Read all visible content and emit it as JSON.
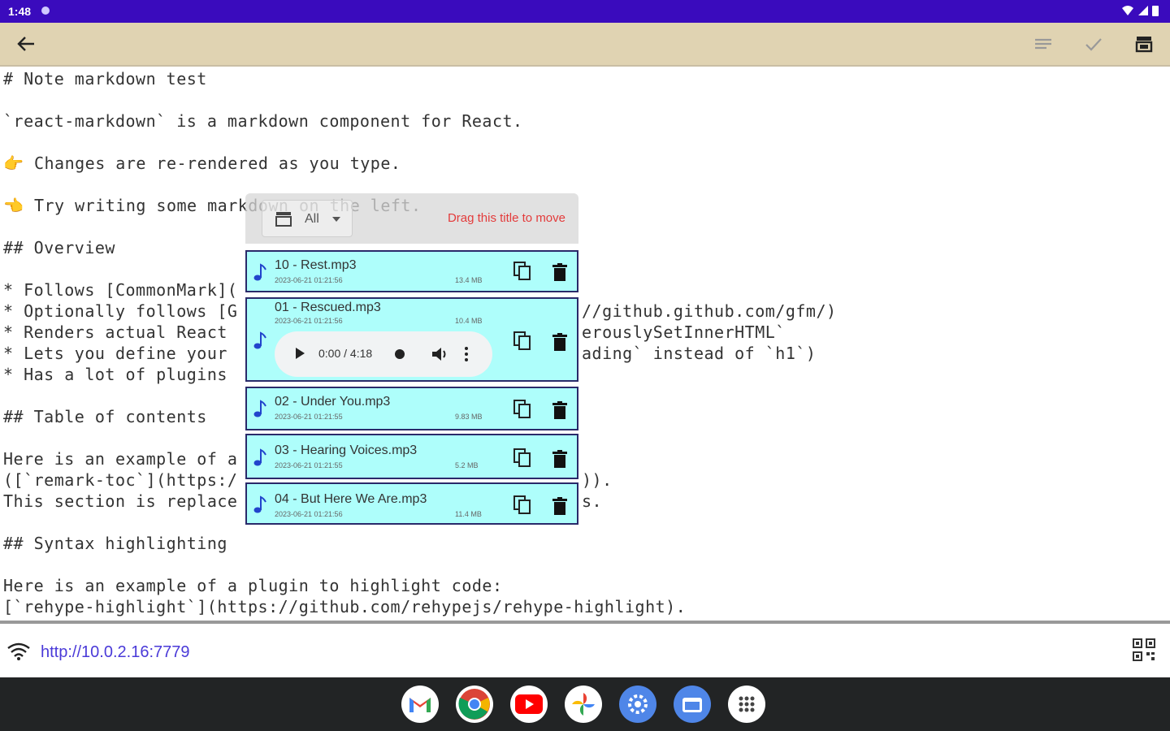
{
  "status_bar": {
    "time": "1:48"
  },
  "app_bar": {
    "back_icon": "arrow-left-icon",
    "actions": [
      "wrap-text-icon",
      "check-icon",
      "music-list-icon"
    ]
  },
  "editor": {
    "lines": [
      "# Note markdown test",
      "",
      "`react-markdown` is a markdown component for React.",
      "",
      "👉 Changes are re-rendered as you type.",
      "",
      "👈 Try writing some markdown on the left.",
      "",
      "## Overview",
      "",
      "* Follows [CommonMark](",
      "* Optionally follows [G",
      "* Renders actual React",
      "* Lets you define your",
      "* Has a lot of plugins",
      "",
      "## Table of contents",
      "",
      "Here is an example of a",
      "([`remark-toc`](https:/",
      "This section is replace",
      "",
      "## Syntax highlighting",
      "",
      "Here is an example of a plugin to highlight code:",
      "[`rehype-highlight`](https://github.com/rehypejs/rehype-highlight)."
    ],
    "right_fragments": {
      "line11": "//github.github.com/gfm/)",
      "line12": "erouslySetInnerHTML`",
      "line13": "ading` instead of `h1`)",
      "line19": ")).",
      "line20": "s."
    }
  },
  "music_panel": {
    "filter_label": "All",
    "drag_hint": "Drag this title to move",
    "tracks": [
      {
        "name": "10 - Rest.mp3",
        "date": "2023-06-21 01:21:56",
        "size": "13.4 MB"
      },
      {
        "name": "01 - Rescued.mp3",
        "date": "2023-06-21 01:21:56",
        "size": "10.4 MB",
        "playing": true
      },
      {
        "name": "02 - Under You.mp3",
        "date": "2023-06-21 01:21:55",
        "size": "9.83 MB"
      },
      {
        "name": "03 - Hearing Voices.mp3",
        "date": "2023-06-21 01:21:55",
        "size": "5.2 MB"
      },
      {
        "name": "04 - But Here We Are.mp3",
        "date": "2023-06-21 01:21:56",
        "size": "11.4 MB"
      }
    ],
    "player": {
      "time": "0:00 / 4:18"
    }
  },
  "url_bar": {
    "url": "http://10.0.2.16:7779"
  },
  "taskbar": {
    "apps": [
      "gmail-icon",
      "chrome-icon",
      "youtube-icon",
      "photos-icon",
      "settings-icon",
      "files-icon",
      "app-launcher-icon"
    ]
  },
  "colors": {
    "status_bar": "#3a0bbd",
    "app_bar": "#e0d3b2",
    "track_bg": "#aefefb",
    "drag_hint": "#e33b3b",
    "url": "#4a3ad8"
  }
}
